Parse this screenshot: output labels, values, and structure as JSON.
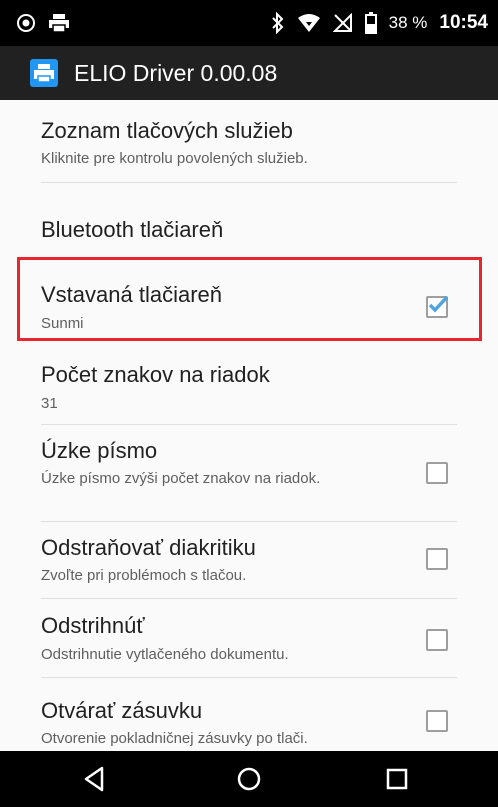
{
  "status_bar": {
    "battery_percent": "38 %",
    "time": "10:54",
    "icons": [
      "notification-icon",
      "print-icon",
      "bluetooth-icon",
      "wifi-icon",
      "no-signal-icon",
      "battery-icon"
    ]
  },
  "app_bar": {
    "title": "ELIO Driver 0.00.08",
    "icon": "printer-icon"
  },
  "settings": {
    "items": [
      {
        "title": "Zoznam tlačových služieb",
        "summary": "Kliknite pre kontrolu povolených služieb."
      },
      {
        "title": "Bluetooth tlačiareň",
        "summary": ""
      },
      {
        "title": "Vstavaná tlačiareň",
        "summary": "Sunmi",
        "checked": true
      },
      {
        "title": "Počet znakov na riadok",
        "summary": "31"
      },
      {
        "title": "Úzke písmo",
        "summary": "Úzke písmo zvýši počet znakov na riadok.",
        "checked": false
      },
      {
        "title": "Odstraňovať diakritiku",
        "summary": "Zvoľte pri problémoch s tlačou.",
        "checked": false
      },
      {
        "title": "Odstrihnúť",
        "summary": "Odstrihnutie vytlačeného dokumentu.",
        "checked": false
      },
      {
        "title": "Otvárať zásuvku",
        "summary": "Otvorenie pokladničnej zásuvky po tlači.",
        "checked": false
      }
    ]
  },
  "nav_bar": {
    "buttons": [
      "back-icon",
      "home-icon",
      "recents-icon"
    ]
  },
  "colors": {
    "accent": "#4fa3de",
    "highlight_border": "#e8262f",
    "app_bar": "#212121"
  }
}
